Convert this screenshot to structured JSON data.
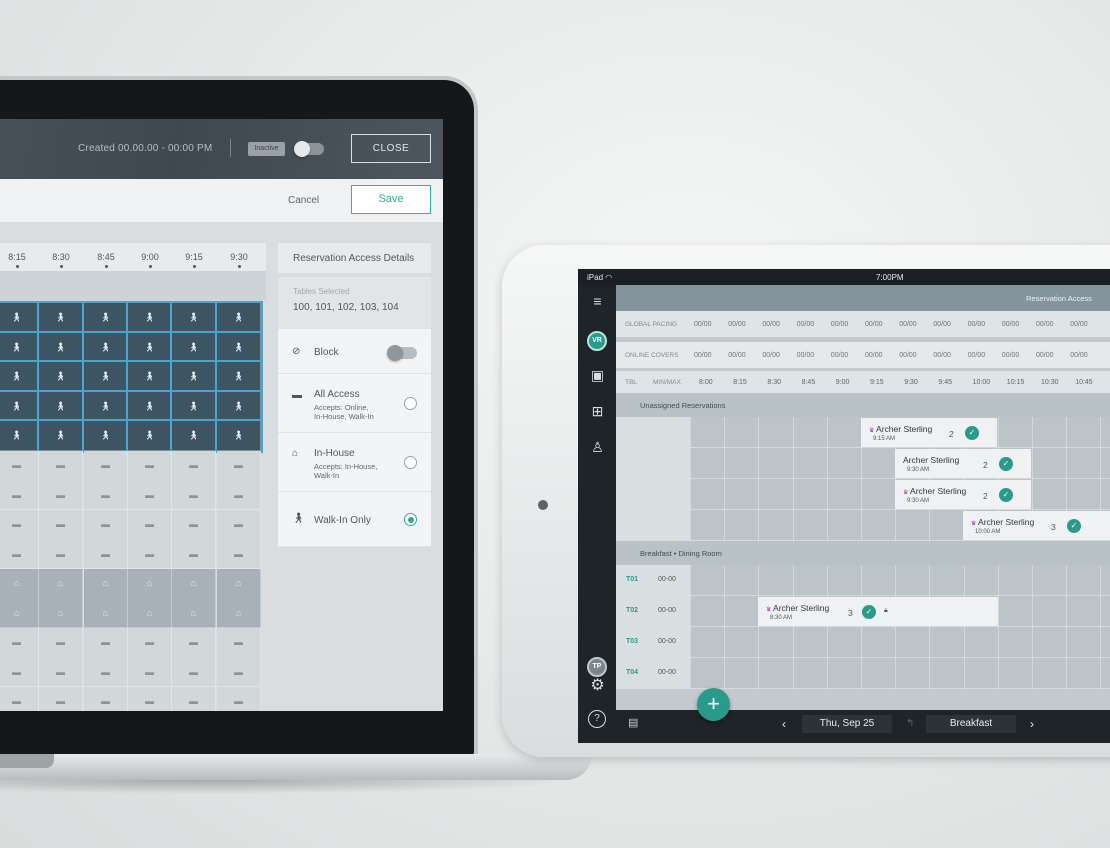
{
  "laptop": {
    "header": {
      "created": "Created 00.00.00 - 00:00 PM",
      "status_badge": "Inactive",
      "close_label": "CLOSE"
    },
    "actions": {
      "cancel_label": "Cancel",
      "save_label": "Save"
    },
    "times": [
      "8:15",
      "8:30",
      "8:45",
      "9:00",
      "9:15",
      "9:30"
    ],
    "icons": {
      "walkin": "walk-in-icon",
      "monitor": "online-access-icon",
      "house": "in-house-icon"
    },
    "panel": {
      "title": "Reservation Access Details",
      "tables_label": "Tables Selected",
      "tables_value": "100, 101, 102, 103, 104",
      "block_label": "Block",
      "all_access_label": "All Access",
      "all_access_sub1": "Accepts: Online,",
      "all_access_sub2": "In-House, Walk-In",
      "in_house_label": "In-House",
      "in_house_sub1": "Accepts: In-House,",
      "in_house_sub2": "Walk-In",
      "walk_in_label": "Walk-In Only"
    }
  },
  "ipad": {
    "status": {
      "device": "iPad",
      "time": "7:00PM"
    },
    "sidebar": {
      "avatar_top": "VR",
      "avatar_bottom": "TP",
      "help": "?"
    },
    "topbar": {
      "reservation_access": "Reservation Access"
    },
    "global_pacing_label": "GLOBAL PACING",
    "online_covers_label": "ONLINE COVERS",
    "pacing_value": "00/00",
    "tbl_label": "TBL",
    "minmax_label": "MIN/MAX",
    "times": [
      "8:00",
      "8:15",
      "8:30",
      "8:45",
      "9:00",
      "9:15",
      "9:30",
      "9:45",
      "10:00",
      "10:15",
      "10:30",
      "10:45"
    ],
    "unassigned_label": "Unassigned Reservations",
    "section_label": "Breakfast  •  Dining Room",
    "reservations": [
      {
        "name": "Archer Sterling",
        "time": "9:15 AM",
        "covers": "2"
      },
      {
        "name": "Archer Sterling",
        "time": "9:30 AM",
        "covers": "2"
      },
      {
        "name": "Archer Sterling",
        "time": "9:30 AM",
        "covers": "2"
      },
      {
        "name": "Archer Sterling",
        "time": "10:00 AM",
        "covers": "3"
      }
    ],
    "tables": [
      {
        "id": "T01",
        "minmax": "00-00"
      },
      {
        "id": "T02",
        "minmax": "00-00"
      },
      {
        "id": "T03",
        "minmax": "00-00"
      },
      {
        "id": "T04",
        "minmax": "00-00"
      }
    ],
    "table_reservation": {
      "name": "Archer Sterling",
      "time": "8:30 AM",
      "covers": "3"
    },
    "bottom": {
      "date": "Thu, Sep 25",
      "shift": "Breakfast"
    }
  }
}
